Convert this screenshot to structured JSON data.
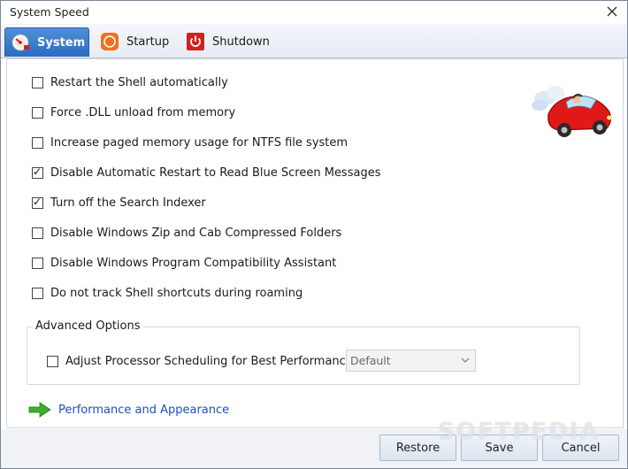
{
  "window": {
    "title": "System Speed"
  },
  "tabs": [
    {
      "label": "System",
      "icon": "system-speedometer-icon",
      "active": true
    },
    {
      "label": "Startup",
      "icon": "startup-icon",
      "active": false
    },
    {
      "label": "Shutdown",
      "icon": "power-icon",
      "active": false
    }
  ],
  "options": [
    {
      "label": "Restart the Shell automatically",
      "checked": false
    },
    {
      "label": "Force .DLL unload from memory",
      "checked": false
    },
    {
      "label": "Increase paged memory usage for NTFS file system",
      "checked": false
    },
    {
      "label": "Disable Automatic Restart to Read Blue Screen Messages",
      "checked": true
    },
    {
      "label": "Turn off the Search Indexer",
      "checked": true
    },
    {
      "label": "Disable Windows Zip and Cab Compressed Folders",
      "checked": false
    },
    {
      "label": "Disable Windows Program Compatibility Assistant",
      "checked": false
    },
    {
      "label": "Do not track Shell shortcuts during roaming",
      "checked": false
    }
  ],
  "advanced": {
    "title": "Advanced Options",
    "processor_label": "Adjust Processor Scheduling for Best Performance of",
    "processor_checked": false,
    "select_value": "Default"
  },
  "link": {
    "label": "Performance and Appearance",
    "icon": "green-arrow-icon"
  },
  "buttons": {
    "restore": "Restore",
    "save": "Save",
    "cancel": "Cancel"
  },
  "watermark": "SOFTPEDIA",
  "colors": {
    "tab_active": "#3a7bd0",
    "link": "#1a4fc4",
    "arrow": "#3ab02a",
    "power": "#d42020",
    "startup": "#f07020"
  }
}
